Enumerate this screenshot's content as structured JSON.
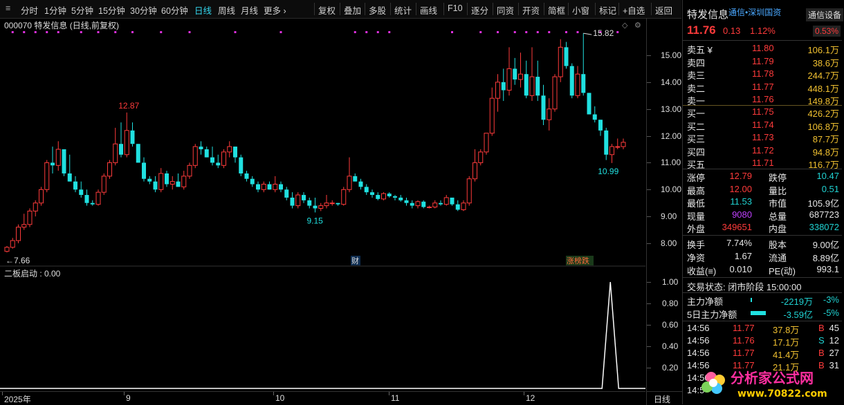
{
  "toolbar": {
    "items": [
      "分时",
      "1分钟",
      "5分钟",
      "15分钟",
      "30分钟",
      "60分钟",
      "日线",
      "周线",
      "月线",
      "更多 ›"
    ],
    "active": "日线",
    "actions": [
      "复权",
      "叠加",
      "多股",
      "统计",
      "画线",
      "F10",
      "逐分",
      "同资",
      "开资",
      "简框",
      "小窗",
      "标记",
      "+自选",
      "返回"
    ]
  },
  "chart": {
    "title": "000070 特发信息 (日线,前复权)",
    "price_ticks": [
      "15.00",
      "14.00",
      "13.00",
      "12.00",
      "11.00",
      "10.00",
      "9.00",
      "8.00"
    ],
    "annotations": {
      "high1": "12.87",
      "low1": "9.15",
      "high2": "15.82",
      "low2": "10.99",
      "start": "←7.66"
    },
    "markers": {
      "cai": "财",
      "bang": "涨榜跌"
    },
    "indicator_title": "二板启动 : 0.00",
    "indicator_ticks": [
      "1.00",
      "0.80",
      "0.60",
      "0.40",
      "0.20"
    ],
    "date_labels": [
      "2025年",
      "9",
      "10",
      "11",
      "12"
    ],
    "period_button": "日线"
  },
  "chart_data": {
    "type": "candlestick",
    "title": "000070 特发信息 (日线,前复权)",
    "ylim": [
      7.5,
      16.5
    ],
    "candles": [
      [
        7.7,
        7.9,
        7.66,
        7.85
      ],
      [
        7.85,
        8.2,
        7.8,
        8.1
      ],
      [
        8.1,
        8.7,
        8.0,
        8.6
      ],
      [
        8.6,
        9.1,
        8.5,
        8.7
      ],
      [
        8.7,
        9.3,
        8.6,
        9.2
      ],
      [
        9.2,
        9.6,
        9.0,
        9.5
      ],
      [
        9.5,
        10.1,
        9.4,
        10.0
      ],
      [
        10.0,
        11.1,
        9.9,
        11.0
      ],
      [
        11.0,
        11.6,
        10.6,
        10.9
      ],
      [
        10.9,
        11.8,
        10.7,
        11.5
      ],
      [
        11.5,
        11.5,
        10.5,
        10.6
      ],
      [
        10.6,
        11.3,
        10.3,
        10.3
      ],
      [
        10.3,
        10.5,
        9.9,
        10.0
      ],
      [
        10.0,
        10.3,
        9.7,
        9.8
      ],
      [
        9.8,
        10.0,
        9.4,
        9.5
      ],
      [
        9.5,
        9.6,
        9.4,
        9.45
      ],
      [
        9.45,
        10.0,
        9.4,
        9.9
      ],
      [
        9.9,
        10.6,
        9.8,
        10.5
      ],
      [
        10.5,
        11.1,
        10.4,
        11.0
      ],
      [
        11.0,
        12.3,
        10.9,
        11.7
      ],
      [
        11.7,
        12.5,
        11.2,
        11.3
      ],
      [
        11.3,
        12.87,
        11.2,
        12.2
      ],
      [
        12.2,
        12.5,
        11.6,
        11.7
      ],
      [
        11.7,
        11.7,
        11.0,
        11.0
      ],
      [
        11.0,
        11.2,
        10.3,
        10.4
      ],
      [
        10.4,
        10.5,
        10.2,
        10.3
      ],
      [
        10.3,
        10.5,
        9.9,
        10.0
      ],
      [
        10.0,
        10.8,
        9.9,
        10.6
      ],
      [
        10.6,
        10.7,
        10.1,
        10.2
      ],
      [
        10.2,
        10.5,
        10.0,
        10.3
      ],
      [
        10.3,
        10.6,
        10.1,
        10.1
      ],
      [
        10.1,
        10.7,
        10.0,
        10.5
      ],
      [
        10.5,
        11.0,
        10.4,
        10.9
      ],
      [
        10.9,
        11.7,
        10.8,
        11.6
      ],
      [
        11.6,
        11.8,
        11.3,
        11.5
      ],
      [
        11.5,
        11.6,
        11.2,
        11.2
      ],
      [
        11.2,
        11.6,
        10.9,
        11.0
      ],
      [
        11.0,
        11.3,
        10.8,
        10.9
      ],
      [
        10.9,
        11.5,
        10.8,
        11.4
      ],
      [
        11.4,
        11.8,
        11.2,
        11.6
      ],
      [
        11.6,
        11.6,
        11.0,
        11.2
      ],
      [
        11.2,
        11.3,
        10.5,
        10.6
      ],
      [
        10.6,
        10.7,
        10.3,
        10.4
      ],
      [
        10.4,
        10.5,
        10.1,
        10.2
      ],
      [
        10.2,
        10.3,
        9.9,
        10.0
      ],
      [
        10.0,
        10.3,
        9.9,
        10.2
      ],
      [
        10.2,
        10.3,
        10.0,
        10.0
      ],
      [
        10.0,
        10.5,
        9.9,
        10.2
      ],
      [
        10.2,
        10.3,
        9.9,
        10.0
      ],
      [
        10.0,
        10.1,
        9.6,
        9.7
      ],
      [
        9.7,
        9.9,
        9.3,
        9.4
      ],
      [
        9.4,
        9.9,
        9.3,
        9.8
      ],
      [
        9.8,
        9.9,
        9.5,
        9.6
      ],
      [
        9.6,
        9.7,
        9.3,
        9.4
      ],
      [
        9.4,
        9.7,
        9.15,
        9.3
      ],
      [
        9.3,
        9.5,
        9.2,
        9.4
      ],
      [
        9.4,
        9.8,
        9.3,
        9.5
      ],
      [
        9.5,
        9.6,
        9.4,
        9.5
      ],
      [
        9.5,
        9.5,
        9.4,
        9.45
      ],
      [
        9.45,
        10.1,
        9.4,
        10.0
      ],
      [
        10.0,
        11.2,
        9.9,
        10.5
      ],
      [
        10.5,
        10.6,
        10.3,
        10.3
      ],
      [
        10.3,
        10.4,
        10.0,
        10.1
      ],
      [
        10.1,
        10.2,
        9.8,
        9.9
      ],
      [
        9.9,
        10.0,
        9.7,
        9.8
      ],
      [
        9.8,
        9.9,
        9.6,
        9.65
      ],
      [
        9.65,
        9.9,
        9.6,
        9.85
      ],
      [
        9.85,
        9.9,
        9.7,
        9.75
      ],
      [
        9.75,
        9.8,
        9.6,
        9.7
      ],
      [
        9.7,
        9.8,
        9.55,
        9.6
      ],
      [
        9.6,
        9.7,
        9.4,
        9.5
      ],
      [
        9.5,
        9.6,
        9.3,
        9.4
      ],
      [
        9.4,
        9.6,
        9.3,
        9.55
      ],
      [
        9.55,
        9.6,
        9.3,
        9.35
      ],
      [
        9.35,
        9.4,
        9.3,
        9.35
      ],
      [
        9.35,
        9.6,
        9.3,
        9.5
      ],
      [
        9.5,
        9.6,
        9.4,
        9.45
      ],
      [
        9.45,
        9.8,
        9.4,
        9.7
      ],
      [
        9.7,
        9.7,
        9.4,
        9.45
      ],
      [
        9.45,
        9.6,
        9.2,
        9.25
      ],
      [
        9.25,
        9.6,
        9.2,
        9.5
      ],
      [
        9.5,
        10.5,
        9.4,
        10.4
      ],
      [
        10.4,
        11.5,
        10.3,
        11.0
      ],
      [
        11.0,
        11.5,
        10.9,
        11.4
      ],
      [
        11.4,
        12.1,
        11.3,
        12.1
      ],
      [
        12.1,
        13.8,
        12.0,
        13.4
      ],
      [
        13.4,
        14.3,
        12.9,
        14.0
      ],
      [
        14.0,
        14.5,
        13.3,
        13.7
      ],
      [
        13.7,
        15.3,
        13.5,
        14.5
      ],
      [
        14.5,
        14.9,
        13.9,
        14.1
      ],
      [
        14.1,
        15.1,
        13.8,
        14.3
      ],
      [
        14.3,
        14.8,
        13.4,
        13.5
      ],
      [
        13.5,
        15.3,
        13.3,
        14.2
      ],
      [
        14.2,
        14.8,
        13.3,
        13.5
      ],
      [
        13.5,
        13.9,
        12.4,
        12.6
      ],
      [
        12.6,
        13.4,
        12.2,
        13.0
      ],
      [
        13.0,
        14.3,
        12.9,
        14.2
      ],
      [
        14.2,
        15.6,
        14.0,
        15.3
      ],
      [
        15.3,
        15.5,
        14.5,
        14.6
      ],
      [
        14.6,
        14.7,
        13.4,
        13.5
      ],
      [
        13.5,
        14.6,
        13.4,
        14.3
      ],
      [
        14.3,
        15.82,
        13.5,
        13.6
      ],
      [
        13.6,
        13.6,
        12.8,
        12.8
      ],
      [
        12.8,
        13.1,
        12.5,
        12.6
      ],
      [
        12.6,
        12.6,
        12.0,
        12.2
      ],
      [
        12.2,
        12.3,
        11.1,
        11.3
      ],
      [
        11.3,
        11.7,
        10.99,
        11.6
      ],
      [
        11.6,
        11.9,
        11.5,
        11.6
      ],
      [
        11.6,
        11.9,
        11.5,
        11.76
      ]
    ],
    "indicator": {
      "name": "二板启动",
      "peak_index": 105,
      "values_range": [
        0,
        1
      ]
    }
  },
  "panel": {
    "stock_name": "特发信息",
    "sector": "通信•深圳国资",
    "sector_right": "通信设备",
    "price": "11.76",
    "change": "0.13",
    "change_pct": "1.12%",
    "sector_pct": "0.53%",
    "asks": [
      {
        "label": "卖五 ¥",
        "price": "11.80",
        "vol": "106.1万"
      },
      {
        "label": "卖四",
        "price": "11.79",
        "vol": "38.6万"
      },
      {
        "label": "卖三",
        "price": "11.78",
        "vol": "244.7万"
      },
      {
        "label": "卖二",
        "price": "11.77",
        "vol": "448.1万"
      },
      {
        "label": "卖一",
        "price": "11.76",
        "vol": "149.8万"
      }
    ],
    "bids": [
      {
        "label": "买一",
        "price": "11.75",
        "vol": "426.2万"
      },
      {
        "label": "买二",
        "price": "11.74",
        "vol": "106.8万"
      },
      {
        "label": "买三",
        "price": "11.73",
        "vol": "87.7万"
      },
      {
        "label": "买四",
        "price": "11.72",
        "vol": "94.8万"
      },
      {
        "label": "买五",
        "price": "11.71",
        "vol": "116.7万"
      }
    ],
    "stats": [
      {
        "l1": "涨停",
        "v1": "12.79",
        "c1": "red",
        "l2": "跌停",
        "v2": "10.47",
        "c2": "green"
      },
      {
        "l1": "最高",
        "v1": "12.00",
        "c1": "red",
        "l2": "量比",
        "v2": "0.51",
        "c2": "green"
      },
      {
        "l1": "最低",
        "v1": "11.53",
        "c1": "green",
        "l2": "市值",
        "v2": "105.9亿",
        "c2": "white"
      },
      {
        "l1": "现量",
        "v1": "9080",
        "c1": "purple",
        "l2": "总量",
        "v2": "687723",
        "c2": "white"
      },
      {
        "l1": "外盘",
        "v1": "349651",
        "c1": "red",
        "l2": "内盘",
        "v2": "338072",
        "c2": "green"
      }
    ],
    "stats2": [
      {
        "l1": "换手",
        "v1": "7.74%",
        "l2": "股本",
        "v2": "9.00亿"
      },
      {
        "l1": "净资",
        "v1": "1.67",
        "l2": "流通",
        "v2": "8.89亿"
      },
      {
        "l1": "收益(≡)",
        "v1": "0.010",
        "l2": "PE(动)",
        "v2": "993.1"
      }
    ],
    "trade_status": "交易状态: 闭市阶段 15:00:00",
    "flows": [
      {
        "label": "主力净额",
        "value": "-2219万",
        "pct": "-3%"
      },
      {
        "label": "5日主力净额",
        "value": "-3.59亿",
        "pct": "-5%"
      }
    ],
    "ticks": [
      {
        "time": "14:56",
        "price": "11.77",
        "vol": "37.8万",
        "side": "B",
        "num": "45"
      },
      {
        "time": "14:56",
        "price": "11.76",
        "vol": "17.1万",
        "side": "S",
        "num": "12"
      },
      {
        "time": "14:56",
        "price": "11.77",
        "vol": "41.4万",
        "side": "B",
        "num": "27"
      },
      {
        "time": "14:56",
        "price": "11.77",
        "vol": "21.1万",
        "side": "B",
        "num": "31"
      },
      {
        "time": "14:56",
        "price": "",
        "vol": "",
        "side": "",
        "num": ""
      },
      {
        "time": "14:5",
        "price": "",
        "vol": "",
        "side": "",
        "num": ""
      }
    ],
    "watermark_text": "分析家公式网",
    "watermark_url": "www.70822.com"
  }
}
